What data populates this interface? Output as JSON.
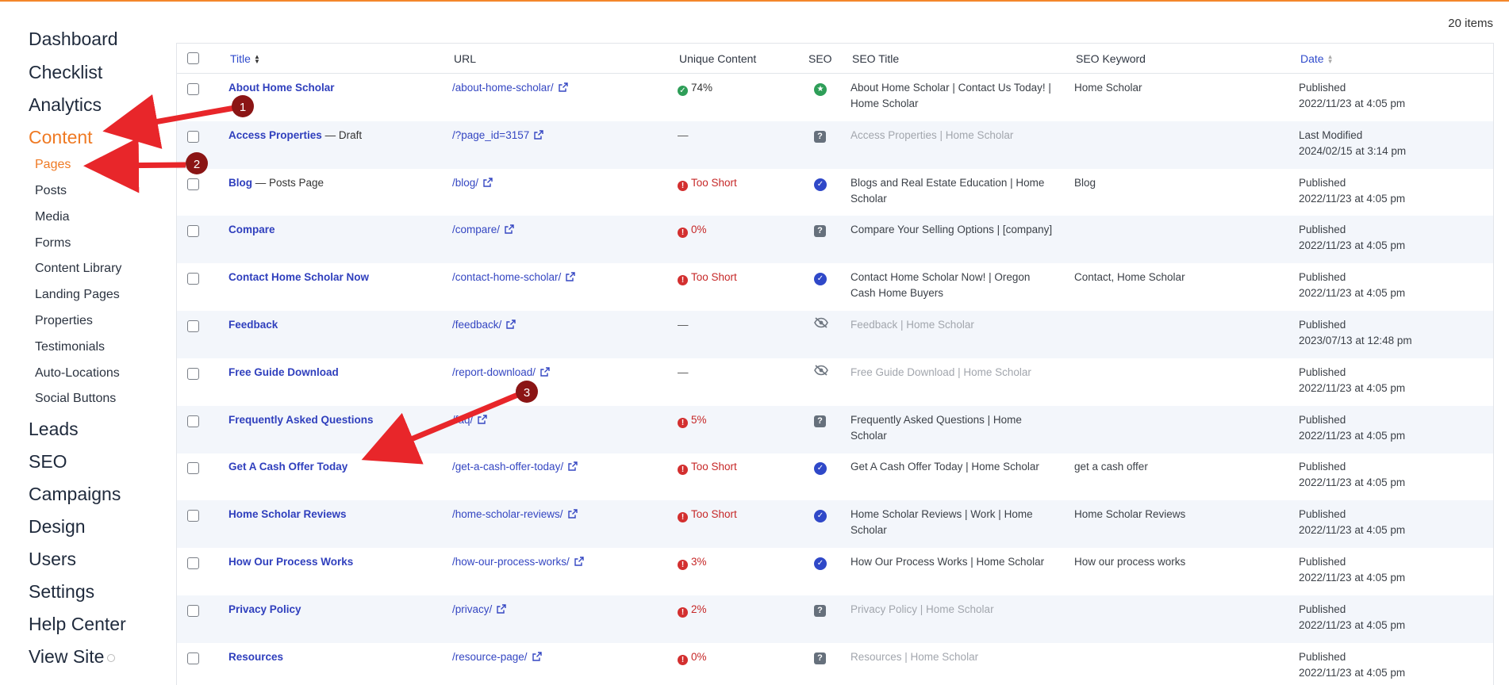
{
  "sidebar": {
    "main_items": [
      {
        "label": "Dashboard"
      },
      {
        "label": "Checklist"
      },
      {
        "label": "Analytics"
      },
      {
        "label": "Content",
        "active": true
      }
    ],
    "sub_items": [
      {
        "label": "Pages",
        "active": true
      },
      {
        "label": "Posts"
      },
      {
        "label": "Media"
      },
      {
        "label": "Forms"
      },
      {
        "label": "Content Library"
      },
      {
        "label": "Landing Pages"
      },
      {
        "label": "Properties"
      },
      {
        "label": "Testimonials"
      },
      {
        "label": "Auto-Locations"
      },
      {
        "label": "Social Buttons"
      }
    ],
    "lower_items": [
      {
        "label": "Leads"
      },
      {
        "label": "SEO"
      },
      {
        "label": "Campaigns"
      },
      {
        "label": "Design"
      },
      {
        "label": "Users"
      },
      {
        "label": "Settings"
      },
      {
        "label": "Help Center"
      },
      {
        "label": "View Site"
      }
    ]
  },
  "items_count": "20 items",
  "table": {
    "headers": {
      "title": "Title",
      "url": "URL",
      "unique_content": "Unique Content",
      "seo": "SEO",
      "seo_title": "SEO Title",
      "seo_keyword": "SEO Keyword",
      "date": "Date"
    },
    "rows": [
      {
        "title": "About Home Scholar",
        "title_extra": "",
        "url": "/about-home-scholar/",
        "uc": "74%",
        "uc_status": "good",
        "seo": "star",
        "seo_title": "About Home Scholar | Contact Us Today! | Home Scholar",
        "seo_title_muted": false,
        "keyword": "Home Scholar",
        "date_status": "Published",
        "date": "2022/11/23 at 4:05 pm"
      },
      {
        "title": "Access Properties",
        "title_extra": " — Draft",
        "url": "/?page_id=3157",
        "uc": "—",
        "uc_status": "none",
        "seo": "question",
        "seo_title": "Access Properties | Home Scholar",
        "seo_title_muted": true,
        "keyword": "",
        "date_status": "Last Modified",
        "date": "2024/02/15 at 3:14 pm"
      },
      {
        "title": "Blog",
        "title_extra": " — Posts Page",
        "url": "/blog/",
        "uc": "Too Short",
        "uc_status": "bad",
        "seo": "check",
        "seo_title": "Blogs and Real Estate Education | Home Scholar",
        "seo_title_muted": false,
        "keyword": "Blog",
        "date_status": "Published",
        "date": "2022/11/23 at 4:05 pm"
      },
      {
        "title": "Compare",
        "title_extra": "",
        "url": "/compare/",
        "uc": "0%",
        "uc_status": "bad",
        "seo": "question",
        "seo_title": "Compare Your Selling Options | [company]",
        "seo_title_muted": false,
        "keyword": "",
        "date_status": "Published",
        "date": "2022/11/23 at 4:05 pm"
      },
      {
        "title": "Contact Home Scholar Now",
        "title_extra": "",
        "url": "/contact-home-scholar/",
        "uc": "Too Short",
        "uc_status": "bad",
        "seo": "check",
        "seo_title": "Contact Home Scholar Now! | Oregon Cash Home Buyers",
        "seo_title_muted": false,
        "keyword": "Contact, Home Scholar",
        "date_status": "Published",
        "date": "2022/11/23 at 4:05 pm"
      },
      {
        "title": "Feedback",
        "title_extra": "",
        "url": "/feedback/",
        "uc": "—",
        "uc_status": "none",
        "seo": "hidden",
        "seo_title": "Feedback | Home Scholar",
        "seo_title_muted": true,
        "keyword": "",
        "date_status": "Published",
        "date": "2023/07/13 at 12:48 pm"
      },
      {
        "title": "Free Guide Download",
        "title_extra": "",
        "url": "/report-download/",
        "uc": "—",
        "uc_status": "none",
        "seo": "hidden",
        "seo_title": "Free Guide Download | Home Scholar",
        "seo_title_muted": true,
        "keyword": "",
        "date_status": "Published",
        "date": "2022/11/23 at 4:05 pm"
      },
      {
        "title": "Frequently Asked Questions",
        "title_extra": "",
        "url": "/faq/",
        "uc": "5%",
        "uc_status": "bad",
        "seo": "question",
        "seo_title": "Frequently Asked Questions | Home Scholar",
        "seo_title_muted": false,
        "keyword": "",
        "date_status": "Published",
        "date": "2022/11/23 at 4:05 pm"
      },
      {
        "title": "Get A Cash Offer Today",
        "title_extra": "",
        "url": "/get-a-cash-offer-today/",
        "uc": "Too Short",
        "uc_status": "bad",
        "seo": "check",
        "seo_title": "Get A Cash Offer Today | Home Scholar",
        "seo_title_muted": false,
        "keyword": "get a cash offer",
        "date_status": "Published",
        "date": "2022/11/23 at 4:05 pm"
      },
      {
        "title": "Home Scholar Reviews",
        "title_extra": "",
        "url": "/home-scholar-reviews/",
        "uc": "Too Short",
        "uc_status": "bad",
        "seo": "check",
        "seo_title": "Home Scholar Reviews | Work | Home Scholar",
        "seo_title_muted": false,
        "keyword": "Home Scholar Reviews",
        "date_status": "Published",
        "date": "2022/11/23 at 4:05 pm"
      },
      {
        "title": "How Our Process Works",
        "title_extra": "",
        "url": "/how-our-process-works/",
        "uc": "3%",
        "uc_status": "bad",
        "seo": "check",
        "seo_title": "How Our Process Works | Home Scholar",
        "seo_title_muted": false,
        "keyword": "How our process works",
        "date_status": "Published",
        "date": "2022/11/23 at 4:05 pm"
      },
      {
        "title": "Privacy Policy",
        "title_extra": "",
        "url": "/privacy/",
        "uc": "2%",
        "uc_status": "bad",
        "seo": "question",
        "seo_title": "Privacy Policy | Home Scholar",
        "seo_title_muted": true,
        "keyword": "",
        "date_status": "Published",
        "date": "2022/11/23 at 4:05 pm"
      },
      {
        "title": "Resources",
        "title_extra": "",
        "url": "/resource-page/",
        "uc": "0%",
        "uc_status": "bad",
        "seo": "question",
        "seo_title": "Resources | Home Scholar",
        "seo_title_muted": true,
        "keyword": "",
        "date_status": "Published",
        "date": "2022/11/23 at 4:05 pm"
      }
    ]
  },
  "annotations": {
    "markers": [
      "1",
      "2",
      "3"
    ],
    "arrow_color": "#e8262a",
    "marker_color": "#8b1515"
  },
  "colors": {
    "accent": "#ef7a24",
    "link": "#2f3fbd",
    "error": "#d32f2f",
    "success": "#2e9e58"
  }
}
